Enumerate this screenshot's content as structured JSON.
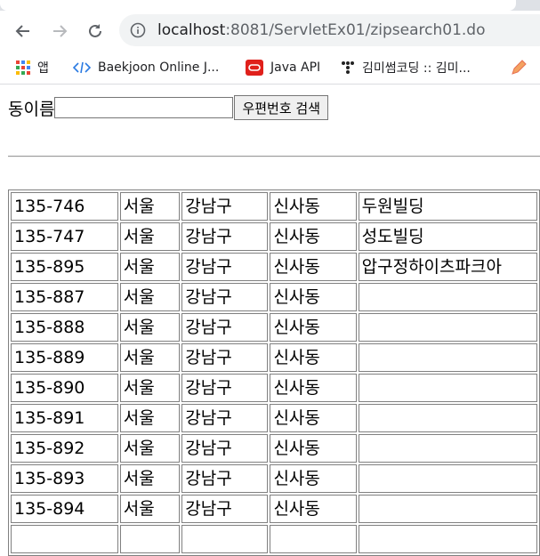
{
  "browser": {
    "url_host": "localhost",
    "url_rest": ":8081/ServletEx01/zipsearch01.do",
    "bookmarks": [
      {
        "label": "앱",
        "icon": "apps-grid-icon"
      },
      {
        "label": "Baekjoon Online J...",
        "icon": "code-icon"
      },
      {
        "label": "Java API",
        "icon": "oracle-icon"
      },
      {
        "label": "김미썸코딩 :: 김미...",
        "icon": "dots-icon"
      },
      {
        "label": "",
        "icon": "pencil-icon"
      }
    ]
  },
  "form": {
    "label": "동이름",
    "input_value": "",
    "button_label": "우편번호 검색"
  },
  "results": {
    "rows": [
      [
        "135-746",
        "서울",
        "강남구",
        "신사동",
        "두원빌딩"
      ],
      [
        "135-747",
        "서울",
        "강남구",
        "신사동",
        "성도빌딩"
      ],
      [
        "135-895",
        "서울",
        "강남구",
        "신사동",
        "압구정하이츠파크아"
      ],
      [
        "135-887",
        "서울",
        "강남구",
        "신사동",
        ""
      ],
      [
        "135-888",
        "서울",
        "강남구",
        "신사동",
        ""
      ],
      [
        "135-889",
        "서울",
        "강남구",
        "신사동",
        ""
      ],
      [
        "135-890",
        "서울",
        "강남구",
        "신사동",
        ""
      ],
      [
        "135-891",
        "서울",
        "강남구",
        "신사동",
        ""
      ],
      [
        "135-892",
        "서울",
        "강남구",
        "신사동",
        ""
      ],
      [
        "135-893",
        "서울",
        "강남구",
        "신사동",
        ""
      ],
      [
        "135-894",
        "서울",
        "강남구",
        "신사동",
        ""
      ],
      [
        "",
        "",
        "",
        "",
        ""
      ]
    ]
  }
}
